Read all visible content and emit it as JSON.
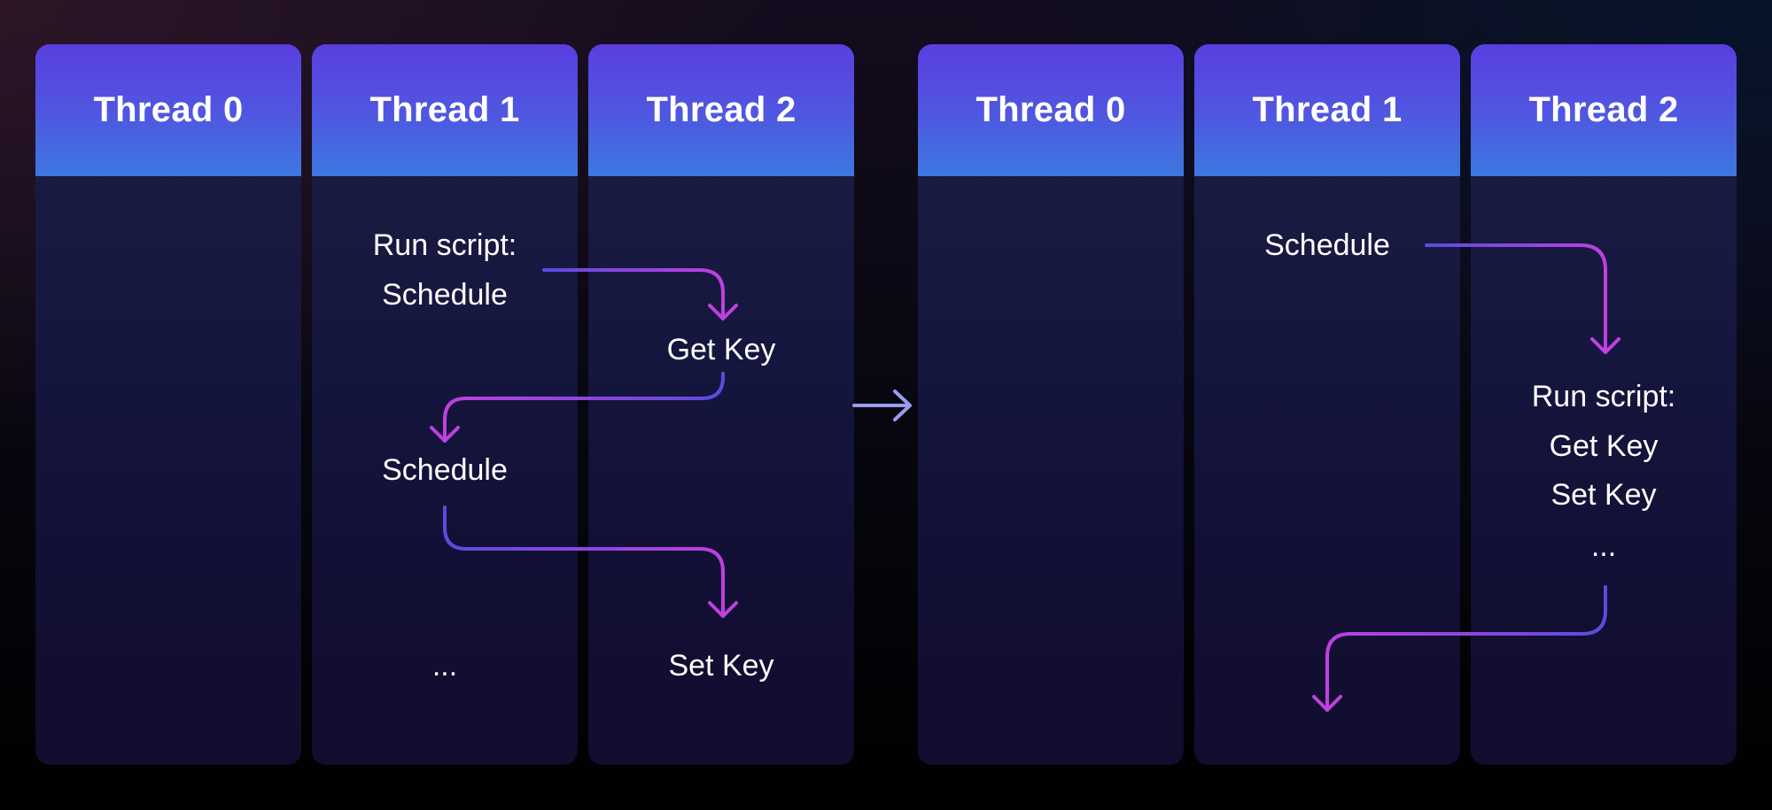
{
  "diagram": {
    "before": {
      "columns": [
        {
          "title": "Thread 0",
          "steps": []
        },
        {
          "title": "Thread 1",
          "steps": [
            "Run script:",
            "Schedule",
            "Schedule",
            "..."
          ]
        },
        {
          "title": "Thread 2",
          "steps": [
            "Get Key",
            "Set Key"
          ]
        }
      ],
      "flows": [
        {
          "from": "Thread 1: Run script: Schedule",
          "to": "Thread 2: Get Key"
        },
        {
          "from": "Thread 2: Get Key",
          "to": "Thread 1: Schedule"
        },
        {
          "from": "Thread 1: Schedule",
          "to": "Thread 2: Set Key"
        }
      ]
    },
    "transition_icon": "right-arrow-icon",
    "after": {
      "columns": [
        {
          "title": "Thread 0",
          "steps": []
        },
        {
          "title": "Thread 1",
          "steps": [
            "Schedule"
          ]
        },
        {
          "title": "Thread 2",
          "steps": [
            "Run script:",
            "Get Key",
            "Set Key",
            "..."
          ]
        }
      ],
      "flows": [
        {
          "from": "Thread 1: Schedule",
          "to": "Thread 2: Run script"
        },
        {
          "from": "Thread 2: ...",
          "to": "Thread 1"
        }
      ]
    }
  },
  "colors": {
    "header_top": "#5a3ee0",
    "header_bottom": "#3c78e0",
    "arrow_start": "#5b4be0",
    "arrow_end": "#c040e0",
    "transition_arrow": "#9a9cf0",
    "text": "#ffffff"
  }
}
